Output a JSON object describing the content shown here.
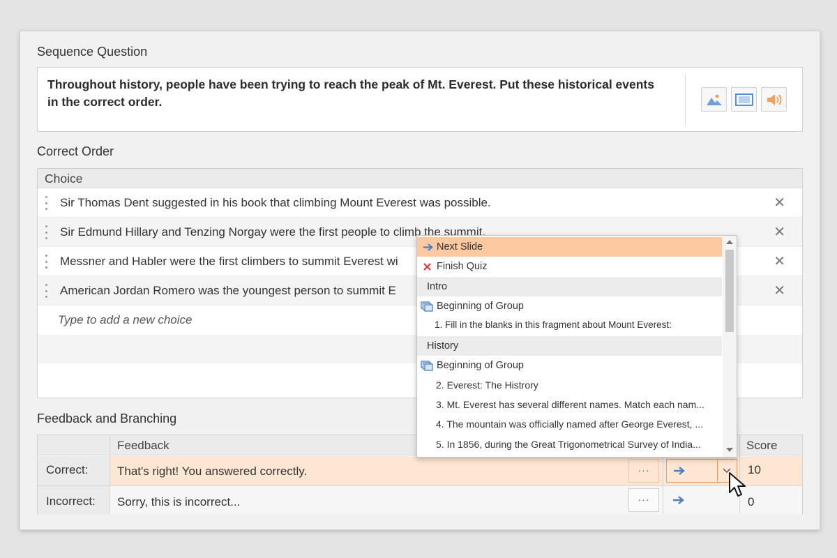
{
  "question": {
    "section_title": "Sequence Question",
    "text": "Throughout history, people have been trying to reach the peak of Mt. Everest. Put these historical events in the correct order.",
    "media_buttons": [
      {
        "icon": "image-icon"
      },
      {
        "icon": "video-icon"
      },
      {
        "icon": "audio-icon"
      }
    ]
  },
  "correct_order": {
    "section_title": "Correct Order",
    "column_header": "Choice",
    "choices": [
      "Sir Thomas Dent suggested in his book that climbing Mount Everest was possible.",
      "Sir Edmund Hillary and Tenzing Norgay were the first people to climb the summit.",
      "Messner and Habler were the first climbers to summit Everest wi",
      "American Jordan Romero was the youngest person to summit E"
    ],
    "add_placeholder": "Type to add a new choice"
  },
  "feedback": {
    "section_title": "Feedback and Branching",
    "headers": {
      "feedback": "Feedback",
      "score": "Score"
    },
    "rows": [
      {
        "label": "Correct:",
        "text": "That's right! You answered correctly.",
        "more": "···",
        "score": "10"
      },
      {
        "label": "Incorrect:",
        "text": "Sorry, this is incorrect...",
        "more": "···",
        "score": "0"
      }
    ]
  },
  "branch_dropdown": {
    "items": [
      {
        "kind": "action",
        "icon": "arrow-right-icon",
        "label": "Next Slide",
        "selected": true
      },
      {
        "kind": "action",
        "icon": "close-red-icon",
        "label": "Finish Quiz"
      },
      {
        "kind": "group",
        "label": "Intro"
      },
      {
        "kind": "action",
        "icon": "group-icon",
        "label": "Beginning of Group"
      },
      {
        "kind": "slide",
        "label": "1. Fill in the blanks in this fragment about Mount Everest:"
      },
      {
        "kind": "group",
        "label": "History"
      },
      {
        "kind": "action",
        "icon": "group-icon",
        "label": "Beginning of Group"
      },
      {
        "kind": "slide",
        "label": "2. Everest: The Histrory"
      },
      {
        "kind": "slide",
        "label": "3. Mt. Everest has several different names. Match each nam..."
      },
      {
        "kind": "slide",
        "label": "4. The mountain was officially named after George Everest, ..."
      },
      {
        "kind": "slide",
        "label": "5. In 1856, during the Great Trigonometrical Survey of India..."
      }
    ]
  },
  "colors": {
    "accent_orange": "#fcc9a1",
    "row_highlight": "#fde6d2",
    "arrow_blue": "#4a7fc1",
    "remove_red": "#e0383e"
  }
}
